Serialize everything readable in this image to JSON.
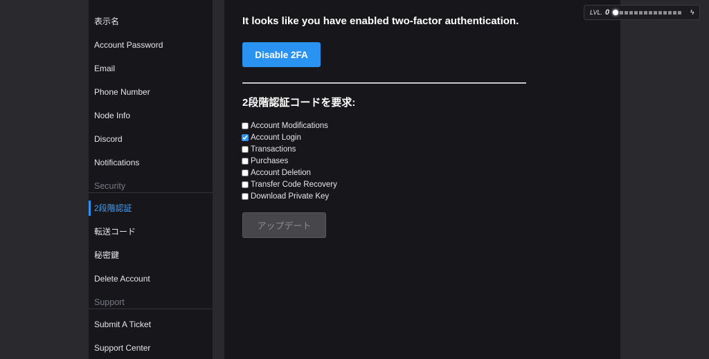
{
  "sidebar": {
    "account_items": [
      {
        "label": "表示名"
      },
      {
        "label": "Account Password"
      },
      {
        "label": "Email"
      },
      {
        "label": "Phone Number"
      },
      {
        "label": "Node Info"
      },
      {
        "label": "Discord"
      },
      {
        "label": "Notifications"
      }
    ],
    "security_title": "Security",
    "security_items": [
      {
        "label": "2段階認証",
        "active": true
      },
      {
        "label": "転送コード"
      },
      {
        "label": "秘密鍵"
      },
      {
        "label": "Delete Account"
      }
    ],
    "support_title": "Support",
    "support_items": [
      {
        "label": "Submit A Ticket"
      },
      {
        "label": "Support Center"
      }
    ]
  },
  "main": {
    "heading": "It looks like you have enabled two-factor authentication.",
    "disable_button": "Disable 2FA",
    "require_heading": "2段階認証コードを要求:",
    "options": [
      {
        "label": "Account Modifications",
        "checked": false
      },
      {
        "label": "Account Login",
        "checked": true
      },
      {
        "label": "Transactions",
        "checked": false
      },
      {
        "label": "Purchases",
        "checked": false
      },
      {
        "label": "Account Deletion",
        "checked": false
      },
      {
        "label": "Transfer Code Recovery",
        "checked": false
      },
      {
        "label": "Download Private Key",
        "checked": false
      }
    ],
    "update_button": "アップデート",
    "update_enabled": false
  },
  "level_widget": {
    "label": "LVL.",
    "level": "0",
    "progress": 0,
    "icon": "bolt-icon"
  },
  "colors": {
    "accent": "#2a92f0",
    "panel": "#17171b",
    "background": "#2a2a2e"
  }
}
